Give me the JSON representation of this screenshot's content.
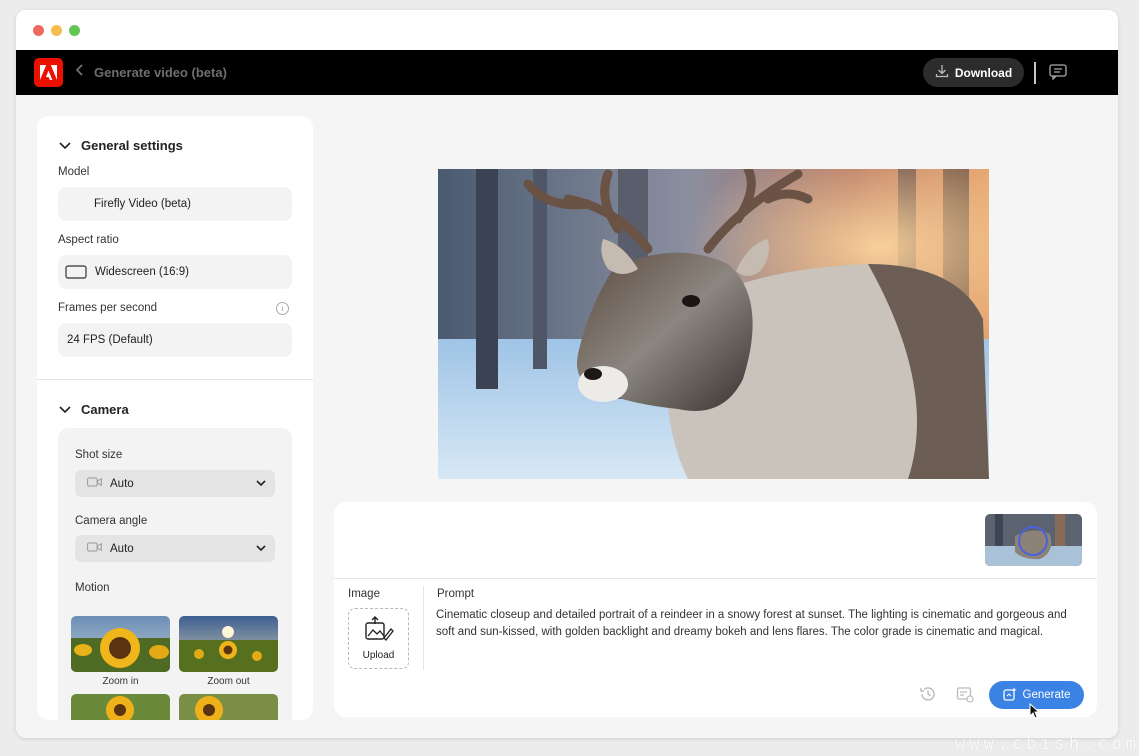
{
  "topbar": {
    "page_title": "Generate video (beta)",
    "download_label": "Download"
  },
  "general_settings": {
    "title": "General settings",
    "model_label": "Model",
    "model_value": "Firefly Video (beta)",
    "aspect_label": "Aspect ratio",
    "aspect_value": "Widescreen (16:9)",
    "fps_label": "Frames per second",
    "fps_value": "24 FPS (Default)"
  },
  "camera": {
    "title": "Camera",
    "shot_size_label": "Shot size",
    "shot_size_value": "Auto",
    "angle_label": "Camera angle",
    "angle_value": "Auto",
    "motion_label": "Motion",
    "motion_options": [
      {
        "label": "Zoom in"
      },
      {
        "label": "Zoom out"
      }
    ]
  },
  "prompt_panel": {
    "image_label": "Image",
    "upload_label": "Upload",
    "prompt_label": "Prompt",
    "prompt_text": "Cinematic closeup and detailed portrait of a reindeer in a snowy forest at sunset. The lighting is cinematic and gorgeous and soft and sun-kissed, with golden backlight and dreamy bokeh and lens flares. The color grade is cinematic and magical.",
    "generate_label": "Generate"
  },
  "watermark": "www.cbish.com",
  "colors": {
    "brand_red": "#eb1000",
    "accent_blue": "#3a83e4",
    "topbar_bg": "#000000"
  },
  "icons": [
    "adobe-logo-icon",
    "back-chevron-icon",
    "download-icon",
    "chat-icon",
    "chevron-down-icon",
    "info-icon",
    "widescreen-icon",
    "video-camera-icon",
    "upload-image-icon",
    "history-icon",
    "settings-icon",
    "generate-sparkle-icon",
    "cursor-icon"
  ]
}
